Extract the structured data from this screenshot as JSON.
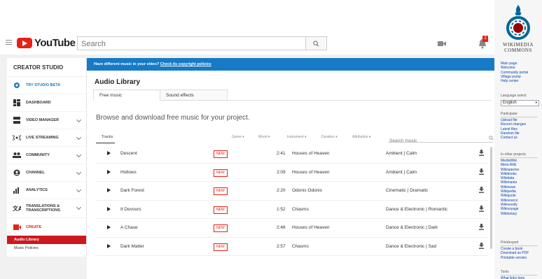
{
  "youtube": {
    "logo_text": "YouTube",
    "logo_tm": "TM",
    "search_placeholder": "Search",
    "notification_count": "2",
    "sidebar": {
      "header": "CREATOR STUDIO",
      "items": [
        {
          "label": "TRY STUDIO BETA",
          "icon": "gear-icon"
        },
        {
          "label": "DASHBOARD",
          "icon": "dashboard-icon"
        },
        {
          "label": "VIDEO MANAGER",
          "icon": "video-manager-icon"
        },
        {
          "label": "LIVE STREAMING",
          "icon": "live-stream-icon"
        },
        {
          "label": "COMMUNITY",
          "icon": "community-icon"
        },
        {
          "label": "CHANNEL",
          "icon": "channel-icon"
        },
        {
          "label": "ANALYTICS",
          "icon": "analytics-icon"
        },
        {
          "label": "TRANSLATIONS & TRANSCRIPTIONS",
          "icon": "translate-icon"
        },
        {
          "label": "CREATE",
          "icon": "create-icon"
        }
      ],
      "sub_items": [
        "Audio Library",
        "Music Policies"
      ]
    },
    "banner": {
      "text": "Have different music in your video? ",
      "link": "Check its copyright policies"
    },
    "library_title": "Audio Library",
    "tabs": [
      "Free music",
      "Sound effects"
    ],
    "browse_heading": "Browse and download free music for your project.",
    "filters": {
      "tracks": "Tracks",
      "genre": "Genre",
      "mood": "Mood",
      "instrument": "Instrument",
      "duration": "Duration",
      "attribution": "Attribution",
      "search_placeholder": "Search music"
    },
    "tracks": [
      {
        "name": "Descent",
        "badge": "NEW",
        "duration": "2:41",
        "artist": "Houses of Heaven",
        "genre": "Ambient | Calm"
      },
      {
        "name": "Hollows",
        "badge": "NEW",
        "duration": "2:09",
        "artist": "Houses of Heaven",
        "genre": "Ambient | Calm"
      },
      {
        "name": "Dark Forest",
        "badge": "NEW",
        "duration": "2:20",
        "artist": "Odonis Odonis",
        "genre": "Cinematic | Dramatic"
      },
      {
        "name": "It Devours",
        "badge": "NEW",
        "duration": "1:52",
        "artist": "Chasms",
        "genre": "Dance & Electronic | Romantic"
      },
      {
        "name": "A Chase",
        "badge": "NEW",
        "duration": "2:46",
        "artist": "Houses of Heaven",
        "genre": "Dance & Electronic | Dark"
      },
      {
        "name": "Dark Matter",
        "badge": "NEW",
        "duration": "2:57",
        "artist": "Chasms",
        "genre": "Dance & Electronic | Sad"
      }
    ],
    "colors": {
      "brand_red": "#e62117",
      "banner_blue": "#167ac6"
    }
  },
  "wiki": {
    "title_line1": "WIKIMEDIA",
    "title_line2": "COMMONS",
    "nav": [
      "Main page",
      "Welcome",
      "Community portal",
      "Village pump",
      "Help center"
    ],
    "language_label": "Language select",
    "language_value": "English",
    "participate_label": "Participate",
    "participate": [
      "Upload file",
      "Recent changes",
      "Latest files",
      "Random file",
      "Contact us"
    ],
    "other_projects_label": "In other projects",
    "other_projects": [
      "MediaWiki",
      "Meta-Wiki",
      "Wikispecies",
      "Wikibooks",
      "Wikidata",
      "Wikimania",
      "Wikinews",
      "Wikipedia",
      "Wikiquote",
      "Wikisource",
      "Wikiversity",
      "Wikivoyage",
      "Wiktionary"
    ],
    "print_label": "Print/export",
    "print": [
      "Create a book",
      "Download as PDF",
      "Printable version"
    ],
    "tools_label": "Tools",
    "tools": [
      "What links here"
    ]
  }
}
